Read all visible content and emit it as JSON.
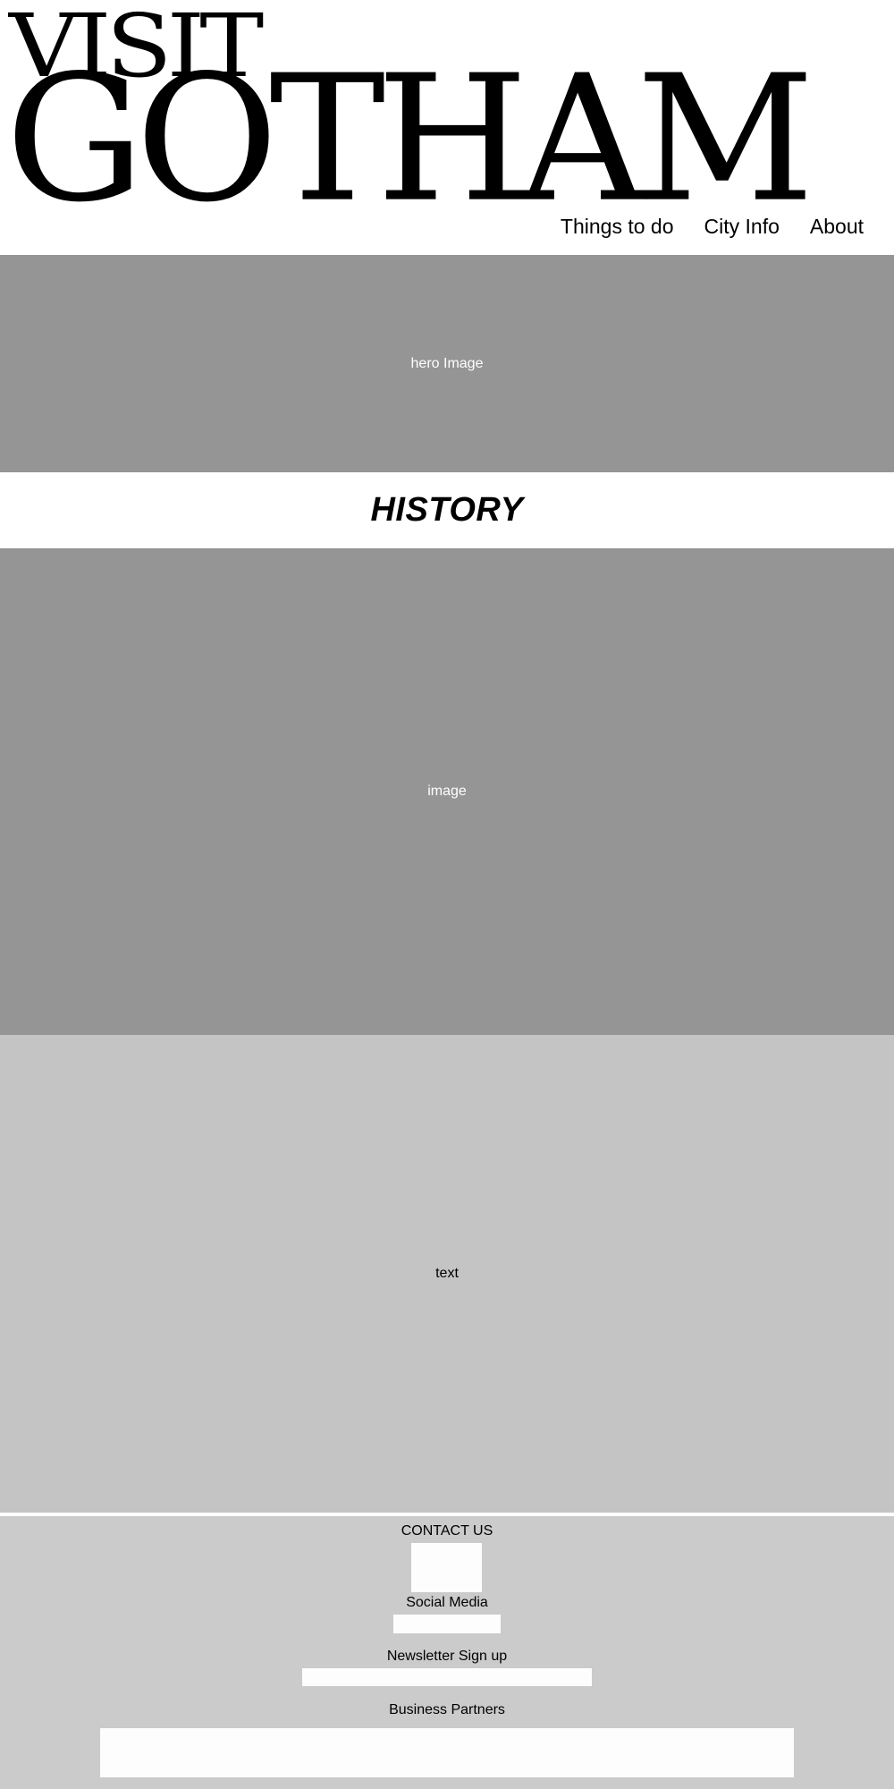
{
  "header": {
    "logo_line1": "VISIT",
    "logo_line2": "GOTHAM",
    "nav": [
      {
        "label": "Things to do"
      },
      {
        "label": "City Info"
      },
      {
        "label": "About"
      }
    ]
  },
  "hero": {
    "label": "hero Image"
  },
  "section": {
    "title": "HISTORY",
    "image_label": "image",
    "text_label": "text"
  },
  "footer": {
    "contact_heading": "CONTACT US",
    "social_heading": "Social Media",
    "newsletter_heading": "Newsletter Sign up",
    "partners_heading": "Business Partners"
  },
  "colors": {
    "placeholder_dark": "#959595",
    "placeholder_light": "#c4c4c4",
    "footer_bg": "#cbcbcb",
    "box_fill": "#fdfdfd"
  }
}
